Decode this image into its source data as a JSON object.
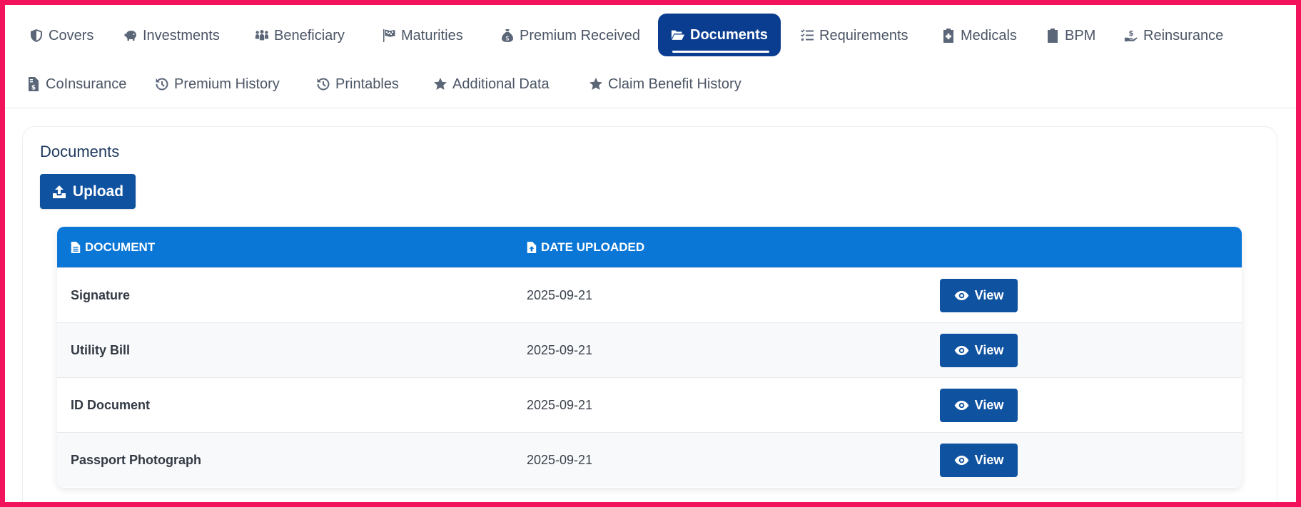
{
  "tabs": [
    {
      "label": "Covers",
      "icon": "shield-icon"
    },
    {
      "label": "Investments",
      "icon": "piggy-bank-icon"
    },
    {
      "label": "Beneficiary",
      "icon": "people-group-icon"
    },
    {
      "label": "Maturities",
      "icon": "checkered-flag-icon"
    },
    {
      "label": "Premium Received",
      "icon": "money-bag-icon"
    },
    {
      "label": "Documents",
      "icon": "folder-open-icon",
      "active": true
    },
    {
      "label": "Requirements",
      "icon": "list-check-icon"
    },
    {
      "label": "Medicals",
      "icon": "medical-file-icon"
    },
    {
      "label": "BPM",
      "icon": "clipboard-check-icon"
    },
    {
      "label": "Reinsurance",
      "icon": "hand-holding-dollar-icon"
    },
    {
      "label": "CoInsurance",
      "icon": "file-invoice-dollar-icon"
    },
    {
      "label": "Premium History",
      "icon": "history-icon"
    },
    {
      "label": "Printables",
      "icon": "history-icon"
    },
    {
      "label": "Additional Data",
      "icon": "star-icon"
    },
    {
      "label": "Claim Benefit History",
      "icon": "star-icon"
    }
  ],
  "documents": {
    "title": "Documents",
    "upload_label": "Upload",
    "columns": {
      "document": "DOCUMENT",
      "date_uploaded": "DATE UPLOADED"
    },
    "rows": [
      {
        "name": "Signature",
        "date": "2025-09-21",
        "action": "View"
      },
      {
        "name": "Utility Bill",
        "date": "2025-09-21",
        "action": "View"
      },
      {
        "name": "ID Document",
        "date": "2025-09-21",
        "action": "View"
      },
      {
        "name": "Passport Photograph",
        "date": "2025-09-21",
        "action": "View"
      }
    ]
  },
  "colors": {
    "frame_border": "#f2135c",
    "active_tab": "#0a3d8f",
    "table_header": "#0a76d6",
    "button": "#0f52a0"
  }
}
